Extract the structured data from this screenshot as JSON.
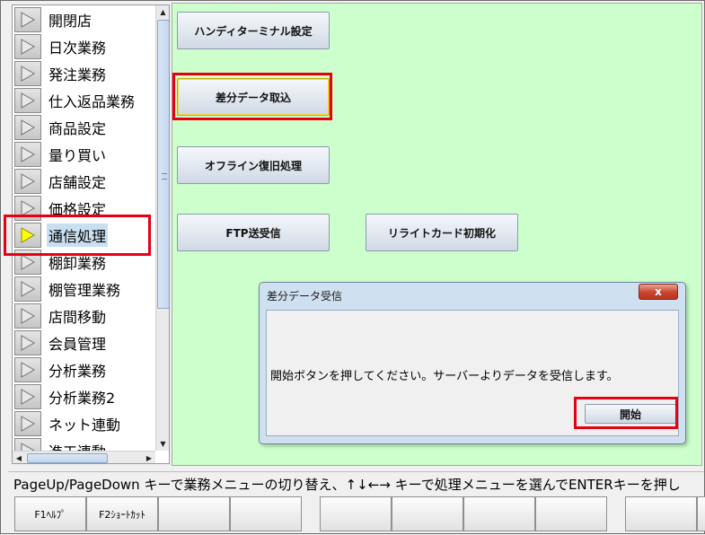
{
  "sidebar": {
    "items": [
      {
        "label": "開閉店"
      },
      {
        "label": "日次業務"
      },
      {
        "label": "発注業務"
      },
      {
        "label": "仕入返品業務"
      },
      {
        "label": "商品設定"
      },
      {
        "label": "量り買い"
      },
      {
        "label": "店舗設定"
      },
      {
        "label": "価格設定"
      },
      {
        "label": "通信処理",
        "selected": true
      },
      {
        "label": "棚卸業務"
      },
      {
        "label": "棚管理業務"
      },
      {
        "label": "店間移動"
      },
      {
        "label": "会員管理"
      },
      {
        "label": "分析業務"
      },
      {
        "label": "分析業務2"
      },
      {
        "label": "ネット連動"
      },
      {
        "label": "進工連動"
      }
    ]
  },
  "main": {
    "buttons": {
      "handy_terminal": "ハンディターミナル設定",
      "diff_import": "差分データ取込",
      "offline_recovery": "オフライン復旧処理",
      "ftp": "FTP送受信",
      "rewrite_card": "リライトカード初期化"
    }
  },
  "dialog": {
    "title": "差分データ受信",
    "close": "x",
    "message": "開始ボタンを押してください。サーバーよりデータを受信します。",
    "start_button": "開始"
  },
  "status": {
    "text": "PageUp/PageDown キーで業務メニューの切り替え、↑↓←→ キーで処理メニューを選んでENTERキーを押し"
  },
  "function_keys": [
    "F1ﾍﾙﾌﾟ",
    "F2ｼｮｰﾄｶｯﾄ",
    "",
    "",
    "",
    "",
    "",
    "",
    "",
    ""
  ],
  "colors": {
    "main_background": "#ccffcc",
    "highlight": "#e60012",
    "selected_arrow": "#ffff00"
  }
}
